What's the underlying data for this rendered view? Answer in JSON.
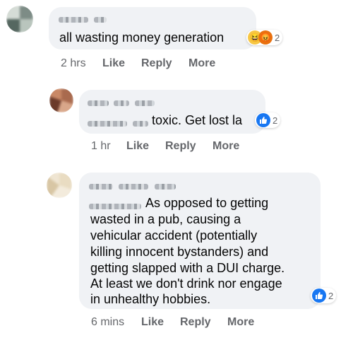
{
  "comments": [
    {
      "text": "all wasting money generation",
      "reaction_count": "2",
      "reactions": [
        "haha-icon",
        "angry-icon"
      ],
      "time": "2 hrs",
      "actions": [
        "Like",
        "Reply",
        "More"
      ]
    },
    {
      "text": "toxic. Get lost la",
      "reaction_count": "2",
      "reactions": [
        "like-icon"
      ],
      "time": "1 hr",
      "actions": [
        "Like",
        "Reply",
        "More"
      ]
    },
    {
      "text_lines": [
        "As opposed to getting",
        "wasted in a pub, causing a",
        "vehicular accident (potentially",
        "killing innocent bystanders) and",
        "getting slapped with a DUI charge.",
        "At least we don't drink nor engage",
        "in unhealthy hobbies."
      ],
      "reaction_count": "2",
      "reactions": [
        "like-icon"
      ],
      "time": "6 mins",
      "actions": [
        "Like",
        "Reply",
        "More"
      ]
    }
  ],
  "colors": {
    "like_blue": "#1877f2",
    "meta_grey": "#65676b",
    "bubble_bg": "#f0f2f5"
  }
}
